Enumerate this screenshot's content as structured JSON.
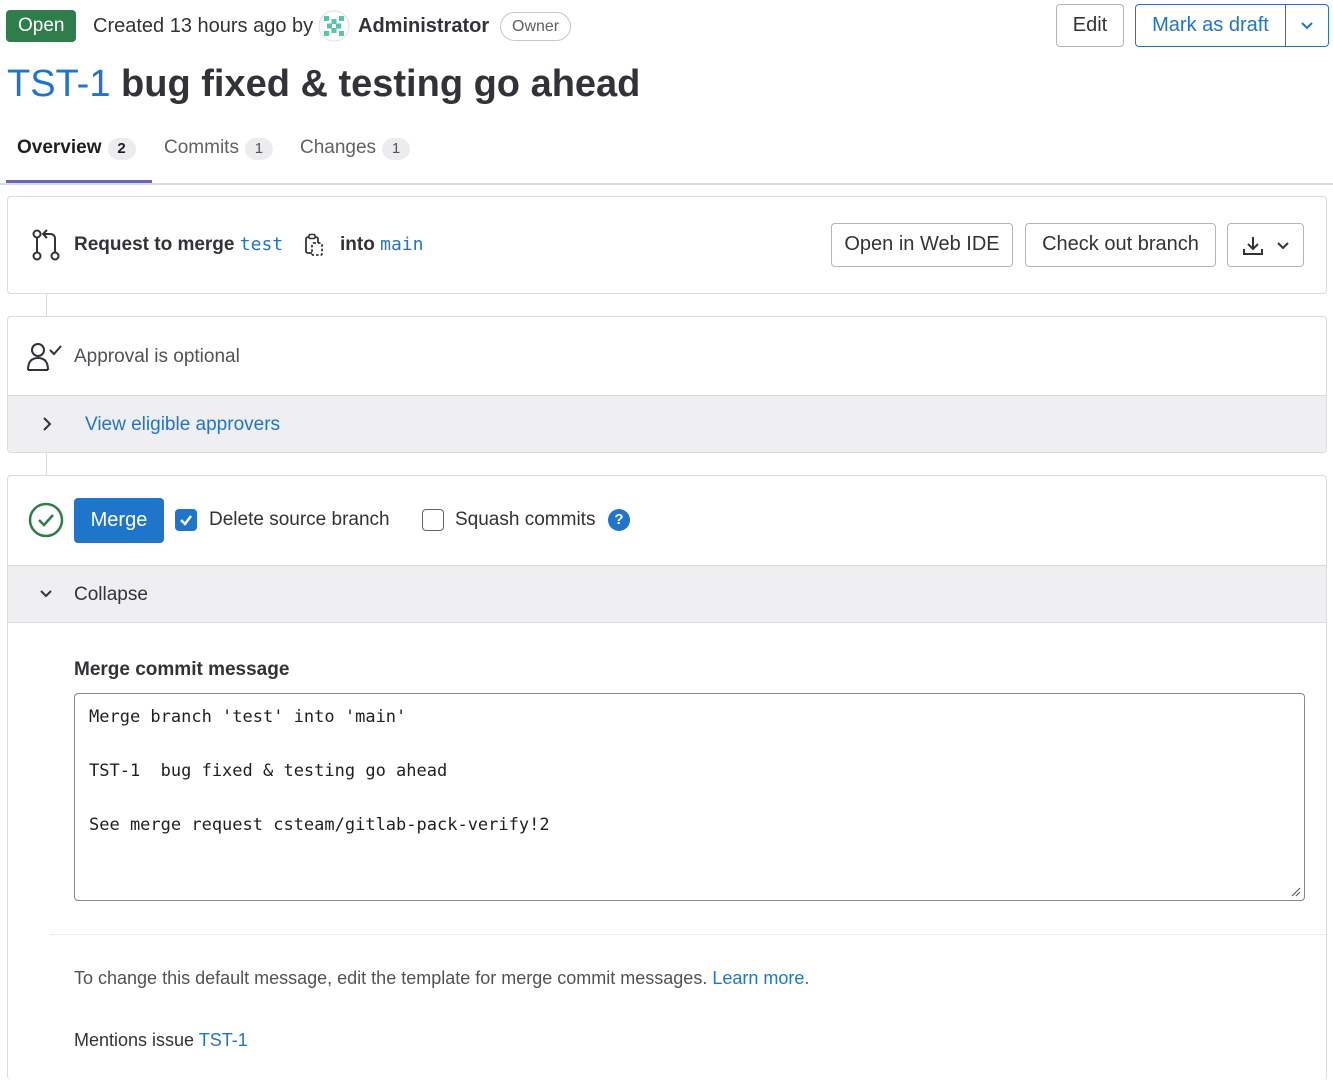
{
  "header": {
    "status": "Open",
    "created_text": "Created 13 hours ago by",
    "author": "Administrator",
    "role_badge": "Owner",
    "edit_label": "Edit",
    "draft_label": "Mark as draft",
    "title_ref": "TST-1",
    "title_text": "bug fixed & testing go ahead"
  },
  "tabs": [
    {
      "label": "Overview",
      "count": "2",
      "active": true
    },
    {
      "label": "Commits",
      "count": "1",
      "active": false
    },
    {
      "label": "Changes",
      "count": "1",
      "active": false
    }
  ],
  "merge_request": {
    "prefix": "Request to merge",
    "source_branch": "test",
    "into": "into",
    "target_branch": "main",
    "web_ide_label": "Open in Web IDE",
    "checkout_label": "Check out branch",
    "download_icon": "download-icon"
  },
  "approval": {
    "text": "Approval is optional",
    "approvers_link": "View eligible approvers"
  },
  "merge": {
    "merge_label": "Merge",
    "delete_source_label": "Delete source branch",
    "delete_source_checked": true,
    "squash_label": "Squash commits",
    "squash_checked": false,
    "help_glyph": "?",
    "collapse_label": "Collapse",
    "commit_heading": "Merge commit message",
    "commit_lines": [
      "Merge branch 'test' into 'main'",
      "",
      "TST-1  bug fixed & testing go ahead",
      "",
      "See merge request csteam/gitlab-pack-verify!2"
    ],
    "hint_text": "To change this default message, edit the template for merge commit messages.",
    "hint_link": "Learn more.",
    "mentions_prefix": "Mentions issue",
    "mentions_link": "TST-1"
  },
  "colors": {
    "accent": "#1f75cb",
    "status_open": "#2f7d4a",
    "tab_underline": "#6666c4",
    "success": "#2f7d4a"
  }
}
